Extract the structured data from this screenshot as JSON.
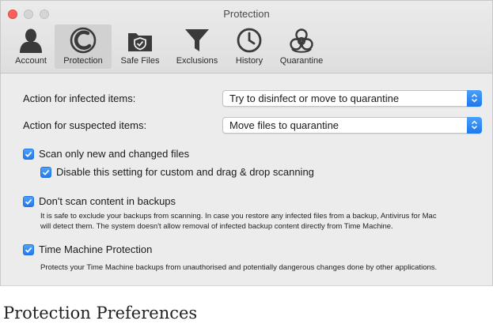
{
  "window": {
    "title": "Protection"
  },
  "toolbar": {
    "items": [
      {
        "label": "Account",
        "icon": "account-icon"
      },
      {
        "label": "Protection",
        "icon": "protection-icon",
        "active": true
      },
      {
        "label": "Safe Files",
        "icon": "safe-files-icon"
      },
      {
        "label": "Exclusions",
        "icon": "exclusions-icon"
      },
      {
        "label": "History",
        "icon": "history-icon"
      },
      {
        "label": "Quarantine",
        "icon": "quarantine-icon"
      }
    ]
  },
  "settings": {
    "infected": {
      "label": "Action for infected items:",
      "value": "Try to disinfect or move to quarantine"
    },
    "suspected": {
      "label": "Action for suspected items:",
      "value": "Move files to quarantine"
    },
    "scan_new": {
      "label": "Scan only new and changed files",
      "checked": true
    },
    "disable_custom": {
      "label": "Disable this setting for custom and drag & drop scanning",
      "checked": true
    },
    "backups": {
      "label": "Don't scan content in backups",
      "checked": true,
      "desc_line1": "It is safe to exclude your backups from scanning. In case you restore any infected files from a backup, Antivirus for Mac",
      "desc_line2": "will detect them. The system doesn't allow removal of infected backup content directly from Time Machine."
    },
    "time_machine": {
      "label": "Time Machine Protection",
      "checked": true,
      "desc": "Protects your Time Machine backups from unauthorised and potentially dangerous changes done by other applications."
    }
  },
  "caption": "Protection Preferences",
  "colors": {
    "accent": "#2479ee",
    "close": "#fc605b"
  }
}
